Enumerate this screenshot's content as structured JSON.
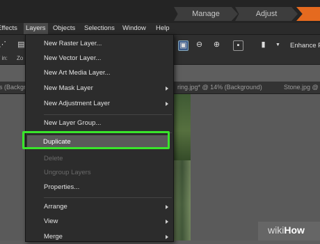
{
  "workspace_tabs": {
    "manage": "Manage",
    "adjust": "Adjust",
    "accent": "#e56a1f"
  },
  "menubar": {
    "effects": "ffects",
    "layers": "Layers",
    "objects": "Objects",
    "selections": "Selections",
    "window": "Window",
    "help": "Help"
  },
  "toolbar": {
    "enhance_label": "Enhance P",
    "partial_left": "/ in:",
    "partial_zoom": "Zo"
  },
  "tabs": {
    "left": "s (Backgr",
    "middle": "ring.jpg*  @  14% (Background)",
    "right": "Stone.jpg  @"
  },
  "layers_menu": {
    "items": [
      {
        "label": "New Raster Layer...",
        "enabled": true,
        "submenu": false
      },
      {
        "label": "New Vector Layer...",
        "enabled": true,
        "submenu": false
      },
      {
        "label": "New Art Media Layer...",
        "enabled": true,
        "submenu": false
      },
      {
        "label": "New Mask Layer",
        "enabled": true,
        "submenu": true
      },
      {
        "label": "New Adjustment Layer",
        "enabled": true,
        "submenu": true
      },
      {
        "label": "New Layer Group...",
        "enabled": true,
        "submenu": false
      },
      {
        "label": "Duplicate",
        "enabled": true,
        "submenu": false,
        "highlighted": true
      },
      {
        "label": "Delete",
        "enabled": false,
        "submenu": false
      },
      {
        "label": "Ungroup Layers",
        "enabled": false,
        "submenu": false
      },
      {
        "label": "Properties...",
        "enabled": true,
        "submenu": false
      },
      {
        "label": "Arrange",
        "enabled": true,
        "submenu": true
      },
      {
        "label": "View",
        "enabled": true,
        "submenu": true
      },
      {
        "label": "Merge",
        "enabled": true,
        "submenu": true
      }
    ],
    "highlight_color": "#39e52b"
  },
  "watermark": {
    "wiki": "wiki",
    "how": "How"
  },
  "icons": [
    "share-icon",
    "document-icon",
    "zoom-fit-icon",
    "zoom-out-icon",
    "zoom-in-icon",
    "actual-size-icon",
    "clipboard-icon",
    "dropdown-caret-icon",
    "submenu-arrow-icon"
  ]
}
